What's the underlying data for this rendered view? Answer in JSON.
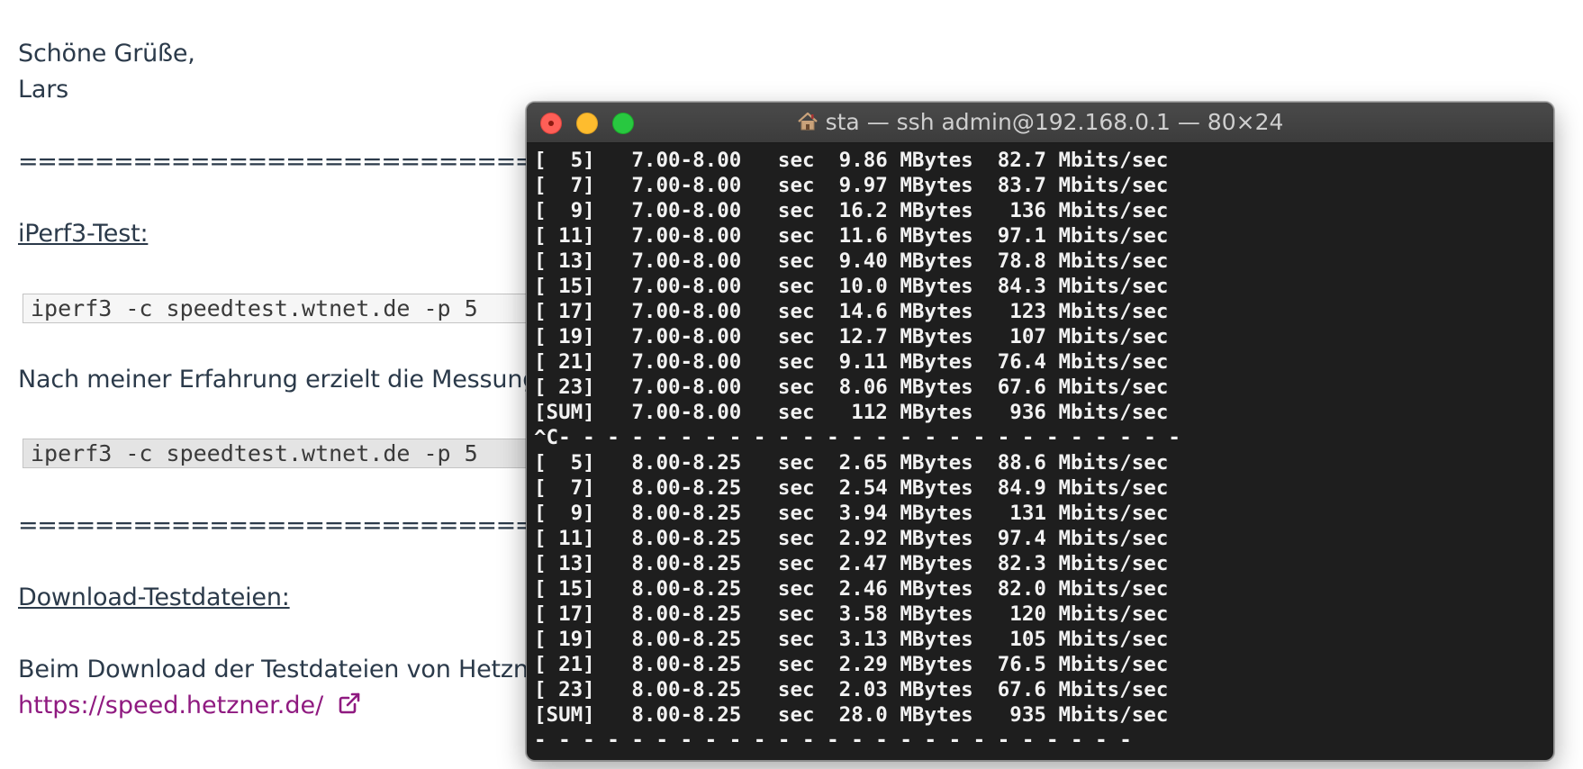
{
  "article": {
    "greeting": "Schöne Grüße,",
    "signature": "Lars",
    "separator_1": "==================================",
    "iperf_heading": "iPerf3-Test:",
    "code_1": "iperf3 -c speedtest.wtnet.de -p 5",
    "paragraph_1": "Nach meiner Erfahrung erzielt die Messung",
    "code_2": "iperf3 -c speedtest.wtnet.de -p 5",
    "separator_2": "==================================",
    "download_heading": "Download-Testdateien:",
    "paragraph_2": "Beim Download der Testdateien von Hetzne",
    "link": "https://speed.hetzner.de/",
    "link_icon": "external-link-icon"
  },
  "terminal": {
    "title": "sta — ssh admin@192.168.0.1 — 80×24",
    "title_icon": "home-icon",
    "lines": [
      "[  5]   7.00-8.00   sec  9.86 MBytes  82.7 Mbits/sec",
      "[  7]   7.00-8.00   sec  9.97 MBytes  83.7 Mbits/sec",
      "[  9]   7.00-8.00   sec  16.2 MBytes   136 Mbits/sec",
      "[ 11]   7.00-8.00   sec  11.6 MBytes  97.1 Mbits/sec",
      "[ 13]   7.00-8.00   sec  9.40 MBytes  78.8 Mbits/sec",
      "[ 15]   7.00-8.00   sec  10.0 MBytes  84.3 Mbits/sec",
      "[ 17]   7.00-8.00   sec  14.6 MBytes   123 Mbits/sec",
      "[ 19]   7.00-8.00   sec  12.7 MBytes   107 Mbits/sec",
      "[ 21]   7.00-8.00   sec  9.11 MBytes  76.4 Mbits/sec",
      "[ 23]   7.00-8.00   sec  8.06 MBytes  67.6 Mbits/sec",
      "[SUM]   7.00-8.00   sec   112 MBytes   936 Mbits/sec",
      "^C- - - - - - - - - - - - - - - - - - - - - - - - - -",
      "[  5]   8.00-8.25   sec  2.65 MBytes  88.6 Mbits/sec",
      "[  7]   8.00-8.25   sec  2.54 MBytes  84.9 Mbits/sec",
      "[  9]   8.00-8.25   sec  3.94 MBytes   131 Mbits/sec",
      "[ 11]   8.00-8.25   sec  2.92 MBytes  97.4 Mbits/sec",
      "[ 13]   8.00-8.25   sec  2.47 MBytes  82.3 Mbits/sec",
      "[ 15]   8.00-8.25   sec  2.46 MBytes  82.0 Mbits/sec",
      "[ 17]   8.00-8.25   sec  3.58 MBytes   120 Mbits/sec",
      "[ 19]   8.00-8.25   sec  3.13 MBytes   105 Mbits/sec",
      "[ 21]   8.00-8.25   sec  2.29 MBytes  76.5 Mbits/sec",
      "[ 23]   8.00-8.25   sec  2.03 MBytes  67.6 Mbits/sec",
      "[SUM]   8.00-8.25   sec  28.0 MBytes   935 Mbits/sec",
      "- - - - - - - - - - - - - - - - - - - - - - - - -"
    ]
  },
  "colors": {
    "text": "#2b3a4a",
    "link": "#8f1a80",
    "terminal_bg": "#1e1e1e",
    "terminal_text": "#f2f2f2"
  }
}
